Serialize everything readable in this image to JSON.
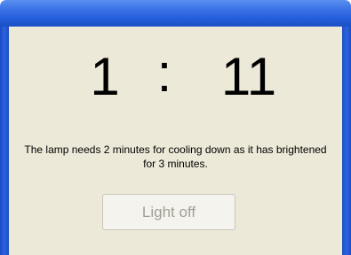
{
  "window": {
    "title": ""
  },
  "timer": {
    "minutes": "1",
    "separator": ":",
    "seconds": "11"
  },
  "message": "The lamp needs 2 minutes for cooling down as it has brightened for 3 minutes.",
  "button": {
    "label": "Light off",
    "enabled": false
  },
  "colors": {
    "titlebar": "#245edb",
    "client_background": "#ece9d8",
    "disabled_text": "#a19f94"
  }
}
